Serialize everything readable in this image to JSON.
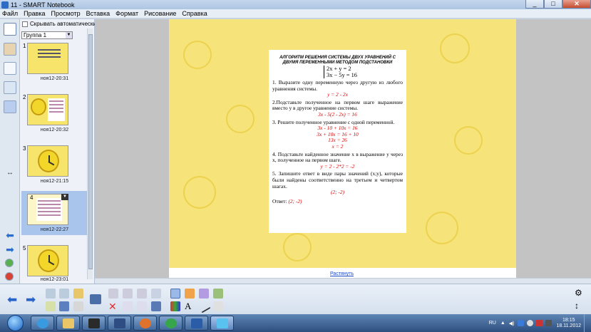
{
  "window": {
    "title": "11 - SMART Notebook",
    "minimize": "_",
    "maximize": "□",
    "close": "✕"
  },
  "menu": [
    "Файл",
    "Правка",
    "Просмотр",
    "Вставка",
    "Формат",
    "Рисование",
    "Справка"
  ],
  "sorter": {
    "autohide_label": "Скрывать автоматически",
    "group": "Группа 1",
    "pages": [
      {
        "num": "1",
        "time": "ноя12-20:31",
        "kind": "text"
      },
      {
        "num": "2",
        "time": "ноя12-20:32",
        "kind": "clock-doc"
      },
      {
        "num": "3",
        "time": "ноя12-21:15",
        "kind": "clock"
      },
      {
        "num": "4",
        "time": "ноя12-22:27",
        "kind": "doc"
      },
      {
        "num": "5",
        "time": "ноя12-23:01",
        "kind": "clock"
      }
    ]
  },
  "content": {
    "heading": "АЛГОРИТМ РЕШЕНИЯ СИСТЕМЫ ДВУХ УРАВНЕНИЙ С ДВУМЯ ПЕРЕМЕННЫМИ МЕТОДОМ ПОДСТАНОВКИ",
    "eq1": "2x + y = 2",
    "eq2": "3x − 5y = 16",
    "step1": "1. Выразите одну переменную через другую из любого уравнения системы.",
    "step1_red": "y = 2 - 2x",
    "step2": "2.Подставьте полученное на первом шаге выражение вместо y в другое уравнение системы.",
    "step2_red": "3x - 5(2 - 2x) = 16",
    "step3": "3. Решите полученное уравнение с одной переменной.",
    "step3_red1": "3x - 10 + 10x = 16",
    "step3_red2": "3x + 10x = 16 + 10",
    "step3_red3": "13x = 26",
    "step3_red4": "x = 2",
    "step4": "4. Подставьте найденное значение x в выражение y через x, полученное на первом шаге.",
    "step4_red": "y = 2 - 2*2 = -2",
    "step5": "5. Запишите ответ в виде пары значений (x;y), которые были найдены соответственно на третьем и четвертом шагах.",
    "step5_red": "(2; -2)",
    "answer_label": "Ответ:",
    "answer_red": "(2; -2)",
    "link": "Растянуть"
  },
  "tray": {
    "lang": "RU",
    "time": "18:15",
    "date": "18.11.2012"
  },
  "colors": {
    "page": "#f6e47a",
    "accent_red": "#d60000",
    "selection": "#a9c5ec"
  }
}
